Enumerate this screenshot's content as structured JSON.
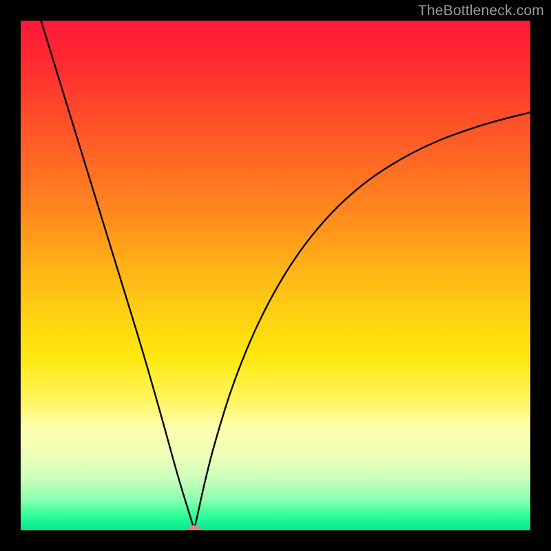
{
  "watermark": "TheBottleneck.com",
  "chart_data": {
    "type": "line",
    "title": "",
    "xlabel": "",
    "ylabel": "",
    "xlim": [
      0,
      100
    ],
    "ylim": [
      0,
      100
    ],
    "notes": "Chart has no axis ticks or numeric labels rendered; values are visual-position estimates on a 0–100 grid. Curve is a sharp V with minimum near x≈34, two branches rising left and right with decreasing slope on the right.",
    "series": [
      {
        "name": "bottleneck-curve",
        "x": [
          4,
          8,
          12,
          16,
          20,
          24,
          28,
          31,
          33.5,
          34,
          34.5,
          36,
          38,
          42,
          48,
          56,
          66,
          78,
          90,
          100
        ],
        "values": [
          100,
          87,
          74,
          61,
          48,
          35,
          21,
          10,
          2,
          0.2,
          2,
          9,
          17,
          30,
          44,
          57,
          67.5,
          75,
          79.5,
          82
        ]
      }
    ],
    "marker": {
      "name": "min-marker",
      "shape": "pill",
      "x": 34,
      "y": 0.2,
      "color": "#d58a8e"
    },
    "background": {
      "type": "vertical-gradient",
      "stops": [
        {
          "pos": 0.0,
          "color": "#ff1838"
        },
        {
          "pos": 0.38,
          "color": "#ff8a1e"
        },
        {
          "pos": 0.66,
          "color": "#ffe80e"
        },
        {
          "pos": 0.86,
          "color": "#eaffb8"
        },
        {
          "pos": 1.0,
          "color": "#00e88c"
        }
      ]
    }
  }
}
